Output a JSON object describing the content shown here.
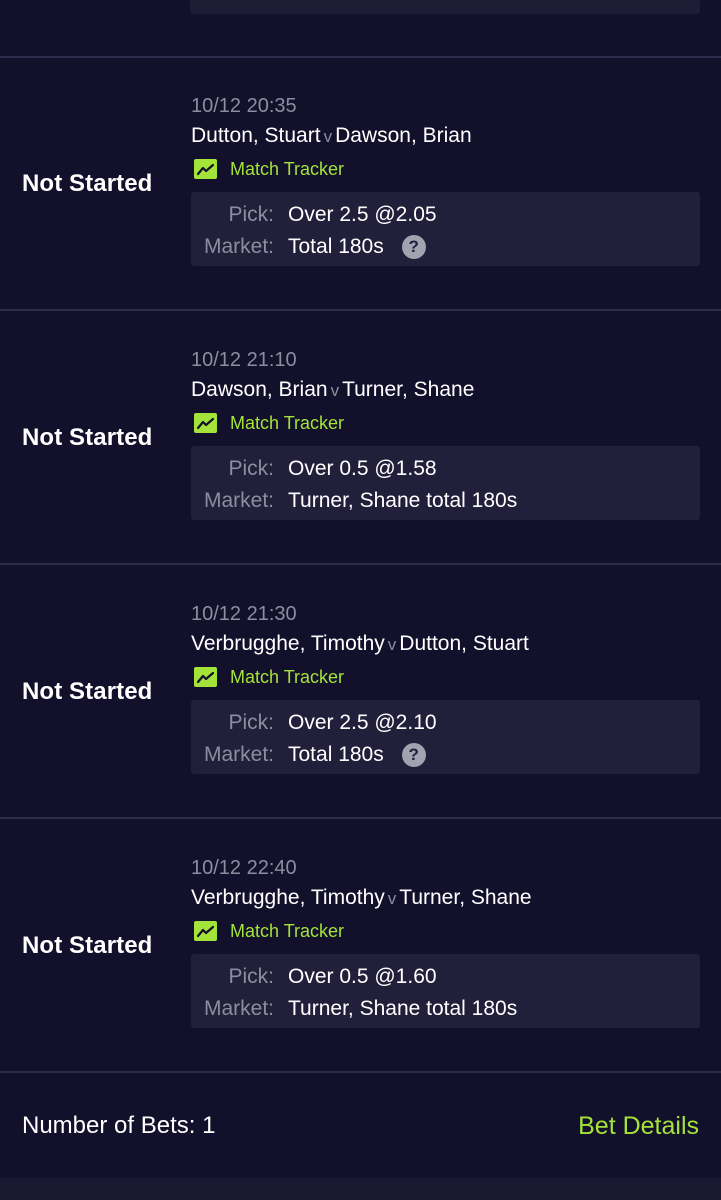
{
  "bets": [
    {
      "status": "Not Started",
      "datetime": "10/12 20:35",
      "home": "Dutton, Stuart",
      "vs": "v",
      "away": "Dawson, Brian",
      "tracker_label": "Match Tracker",
      "pick_label": "Pick:",
      "pick": "Over 2.5 @2.05",
      "market_label": "Market:",
      "market": "Total 180s",
      "has_help": true
    },
    {
      "status": "Not Started",
      "datetime": "10/12 21:10",
      "home": "Dawson, Brian",
      "vs": "v",
      "away": "Turner, Shane",
      "tracker_label": "Match Tracker",
      "pick_label": "Pick:",
      "pick": "Over 0.5 @1.58",
      "market_label": "Market:",
      "market": "Turner, Shane total 180s",
      "has_help": false
    },
    {
      "status": "Not Started",
      "datetime": "10/12 21:30",
      "home": "Verbrugghe, Timothy",
      "vs": "v",
      "away": "Dutton, Stuart",
      "tracker_label": "Match Tracker",
      "pick_label": "Pick:",
      "pick": "Over 2.5 @2.10",
      "market_label": "Market:",
      "market": "Total 180s",
      "has_help": true
    },
    {
      "status": "Not Started",
      "datetime": "10/12 22:40",
      "home": "Verbrugghe, Timothy",
      "vs": "v",
      "away": "Turner, Shane",
      "tracker_label": "Match Tracker",
      "pick_label": "Pick:",
      "pick": "Over 0.5 @1.60",
      "market_label": "Market:",
      "market": "Turner, Shane total 180s",
      "has_help": false
    }
  ],
  "footer": {
    "count": "Number of Bets: 1",
    "details": "Bet Details"
  },
  "icons": {
    "tracker": "chart-trend-icon",
    "help": "question-circle-icon"
  },
  "colors": {
    "background": "#12102a",
    "panel": "#221f3b",
    "accent": "#a4e43a",
    "muted": "#8e8c9f"
  }
}
